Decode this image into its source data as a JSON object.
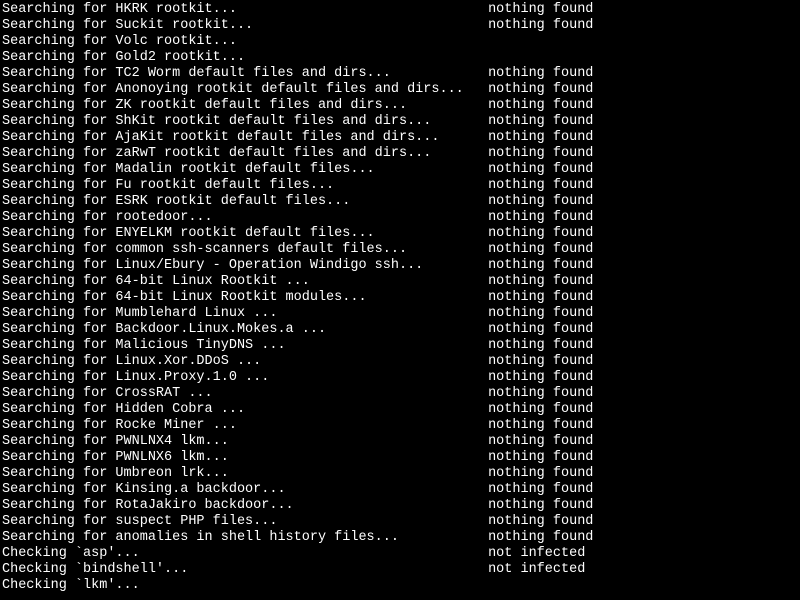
{
  "search_prefix": "Searching for ",
  "check_prefix": "Checking `",
  "status_col": 60,
  "lines": [
    {
      "type": "search",
      "item": "HKRK rootkit...",
      "status": "nothing found"
    },
    {
      "type": "search",
      "item": "Suckit rootkit...",
      "status": "nothing found"
    },
    {
      "type": "search",
      "item": "Volc rootkit...",
      "status": ""
    },
    {
      "type": "search",
      "item": "Gold2 rootkit...",
      "status": ""
    },
    {
      "type": "search",
      "item": "TC2 Worm default files and dirs...",
      "status": "nothing found"
    },
    {
      "type": "search",
      "item": "Anonoying rootkit default files and dirs...",
      "status": "nothing found"
    },
    {
      "type": "search",
      "item": "ZK rootkit default files and dirs...",
      "status": "nothing found"
    },
    {
      "type": "search",
      "item": "ShKit rootkit default files and dirs...",
      "status": "nothing found"
    },
    {
      "type": "search",
      "item": "AjaKit rootkit default files and dirs...",
      "status": "nothing found"
    },
    {
      "type": "search",
      "item": "zaRwT rootkit default files and dirs...",
      "status": "nothing found"
    },
    {
      "type": "search",
      "item": "Madalin rootkit default files...",
      "status": "nothing found"
    },
    {
      "type": "search",
      "item": "Fu rootkit default files...",
      "status": "nothing found"
    },
    {
      "type": "search",
      "item": "ESRK rootkit default files...",
      "status": "nothing found"
    },
    {
      "type": "search",
      "item": "rootedoor...",
      "status": "nothing found"
    },
    {
      "type": "search",
      "item": "ENYELKM rootkit default files...",
      "status": "nothing found"
    },
    {
      "type": "search",
      "item": "common ssh-scanners default files...",
      "status": "nothing found"
    },
    {
      "type": "search",
      "item": "Linux/Ebury - Operation Windigo ssh...",
      "status": "nothing found"
    },
    {
      "type": "search",
      "item": "64-bit Linux Rootkit ...",
      "status": "nothing found"
    },
    {
      "type": "search",
      "item": "64-bit Linux Rootkit modules...",
      "status": "nothing found"
    },
    {
      "type": "search",
      "item": "Mumblehard Linux ...",
      "status": "nothing found"
    },
    {
      "type": "search",
      "item": "Backdoor.Linux.Mokes.a ...",
      "status": "nothing found"
    },
    {
      "type": "search",
      "item": "Malicious TinyDNS ...",
      "status": "nothing found"
    },
    {
      "type": "search",
      "item": "Linux.Xor.DDoS ...",
      "status": "nothing found"
    },
    {
      "type": "search",
      "item": "Linux.Proxy.1.0 ...",
      "status": "nothing found"
    },
    {
      "type": "search",
      "item": "CrossRAT ...",
      "status": "nothing found"
    },
    {
      "type": "search",
      "item": "Hidden Cobra ...",
      "status": "nothing found"
    },
    {
      "type": "search",
      "item": "Rocke Miner ...",
      "status": "nothing found"
    },
    {
      "type": "search",
      "item": "PWNLNX4 lkm...",
      "status": "nothing found"
    },
    {
      "type": "search",
      "item": "PWNLNX6 lkm...",
      "status": "nothing found"
    },
    {
      "type": "search",
      "item": "Umbreon lrk...",
      "status": "nothing found"
    },
    {
      "type": "search",
      "item": "Kinsing.a backdoor...",
      "status": "nothing found"
    },
    {
      "type": "search",
      "item": "RotaJakiro backdoor...",
      "status": "nothing found"
    },
    {
      "type": "search",
      "item": "suspect PHP files...",
      "status": "nothing found"
    },
    {
      "type": "search",
      "item": "anomalies in shell history files...",
      "status": "nothing found"
    },
    {
      "type": "check",
      "item": "asp'...",
      "status": "not infected"
    },
    {
      "type": "check",
      "item": "bindshell'...",
      "status": "not infected"
    },
    {
      "type": "check",
      "item": "lkm'...",
      "status": ""
    }
  ]
}
